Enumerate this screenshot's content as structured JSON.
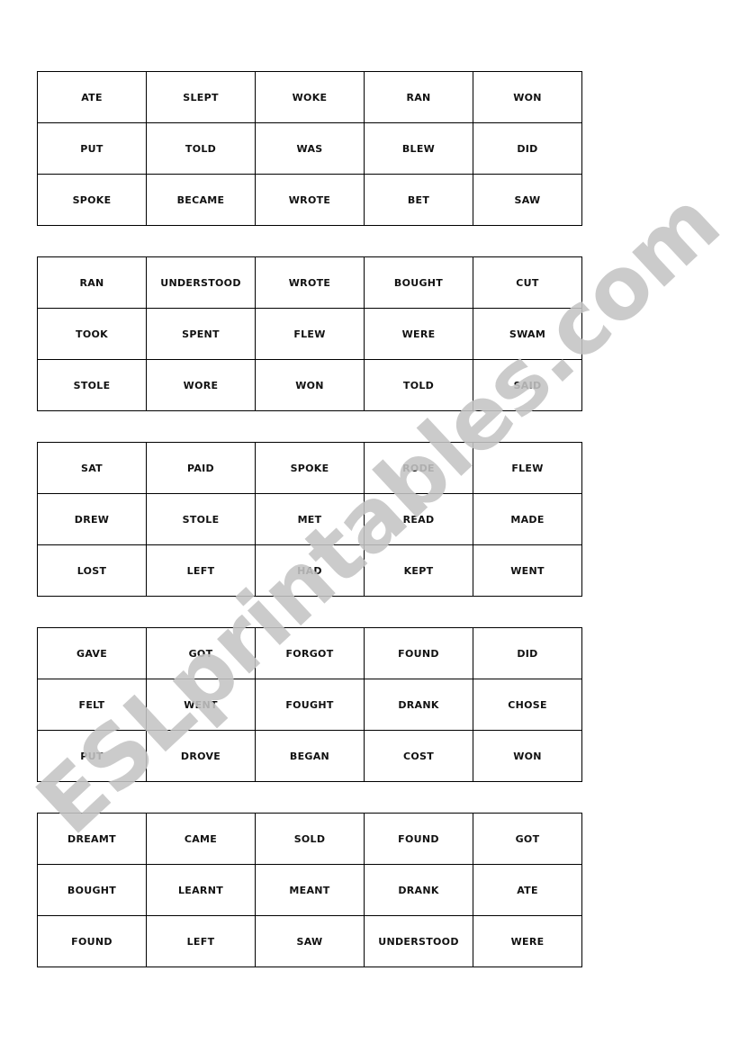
{
  "cards": [
    {
      "rows": [
        [
          "ATE",
          "SLEPT",
          "WOKE",
          "RAN",
          "WON"
        ],
        [
          "PUT",
          "TOLD",
          "WAS",
          "BLEW",
          "DID"
        ],
        [
          "SPOKE",
          "BECAME",
          "WROTE",
          "BET",
          "SAW"
        ]
      ]
    },
    {
      "rows": [
        [
          "RAN",
          "UNDERSTOOD",
          "WROTE",
          "BOUGHT",
          "CUT"
        ],
        [
          "TOOK",
          "SPENT",
          "FLEW",
          "WERE",
          "SWAM"
        ],
        [
          "STOLE",
          "WORE",
          "WON",
          "TOLD",
          "SAID"
        ]
      ]
    },
    {
      "rows": [
        [
          "SAT",
          "PAID",
          "SPOKE",
          "RODE",
          "FLEW"
        ],
        [
          "DREW",
          "STOLE",
          "MET",
          "READ",
          "MADE"
        ],
        [
          "LOST",
          "LEFT",
          "HAD",
          "KEPT",
          "WENT"
        ]
      ]
    },
    {
      "rows": [
        [
          "GAVE",
          "GOT",
          "FORGOT",
          "FOUND",
          "DID"
        ],
        [
          "FELT",
          "WENT",
          "FOUGHT",
          "DRANK",
          "CHOSE"
        ],
        [
          "PUT",
          "DROVE",
          "BEGAN",
          "COST",
          "WON"
        ]
      ]
    },
    {
      "rows": [
        [
          "DREAMT",
          "CAME",
          "SOLD",
          "FOUND",
          "GOT"
        ],
        [
          "BOUGHT",
          "LEARNT",
          "MEANT",
          "DRANK",
          "ATE"
        ],
        [
          "FOUND",
          "LEFT",
          "SAW",
          "UNDERSTOOD",
          "WERE"
        ]
      ]
    }
  ],
  "watermark": {
    "text": "ESLprintables.com",
    "color": "#c4c4c4"
  }
}
